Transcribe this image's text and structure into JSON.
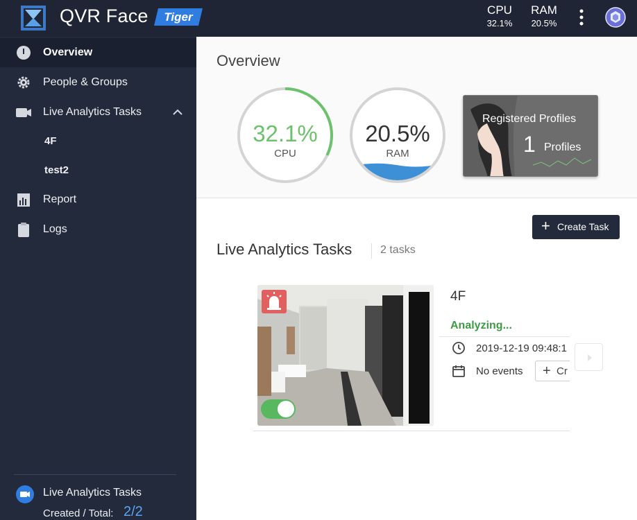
{
  "header": {
    "app_title": "QVR Face",
    "edition": "Tiger",
    "cpu_label": "CPU",
    "cpu_value": "32.1%",
    "ram_label": "RAM",
    "ram_value": "20.5%"
  },
  "sidebar": {
    "items": [
      {
        "label": "Overview",
        "icon": "info-icon",
        "active": true
      },
      {
        "label": "People & Groups",
        "icon": "gear-icon"
      },
      {
        "label": "Live Analytics Tasks",
        "icon": "camera-icon",
        "expanded": true
      },
      {
        "label": "Report",
        "icon": "bar-chart-icon"
      },
      {
        "label": "Logs",
        "icon": "clipboard-icon"
      }
    ],
    "sub_items": [
      {
        "label": "4F"
      },
      {
        "label": "test2"
      }
    ],
    "footer": {
      "title": "Live Analytics Tasks",
      "count_label": "Created / Total:",
      "count_value": "2/2"
    }
  },
  "overview": {
    "title": "Overview",
    "cpu": {
      "value": "32.1%",
      "label": "CPU",
      "fraction": 0.321,
      "color": "#6cc16c"
    },
    "ram": {
      "value": "20.5%",
      "label": "RAM",
      "fraction": 0.205,
      "color": "#3d8fd6"
    },
    "profiles": {
      "title": "Registered Profiles",
      "count": "1",
      "unit": "Profiles"
    }
  },
  "tasks": {
    "title": "Live Analytics Tasks",
    "count_text": "2 tasks",
    "create_label": "Create Task",
    "items": [
      {
        "name": "4F",
        "status": "Analyzing...",
        "time": "2019-12-19 09:48:1",
        "events": "No events",
        "create_label": "Cr",
        "enabled": true
      }
    ]
  },
  "colors": {
    "header_bg": "#1f2535",
    "sidebar_bg": "#232a3b",
    "accent_blue": "#5aa5f5",
    "status_green": "#3e9a46",
    "alarm_red": "#e25f5f"
  }
}
